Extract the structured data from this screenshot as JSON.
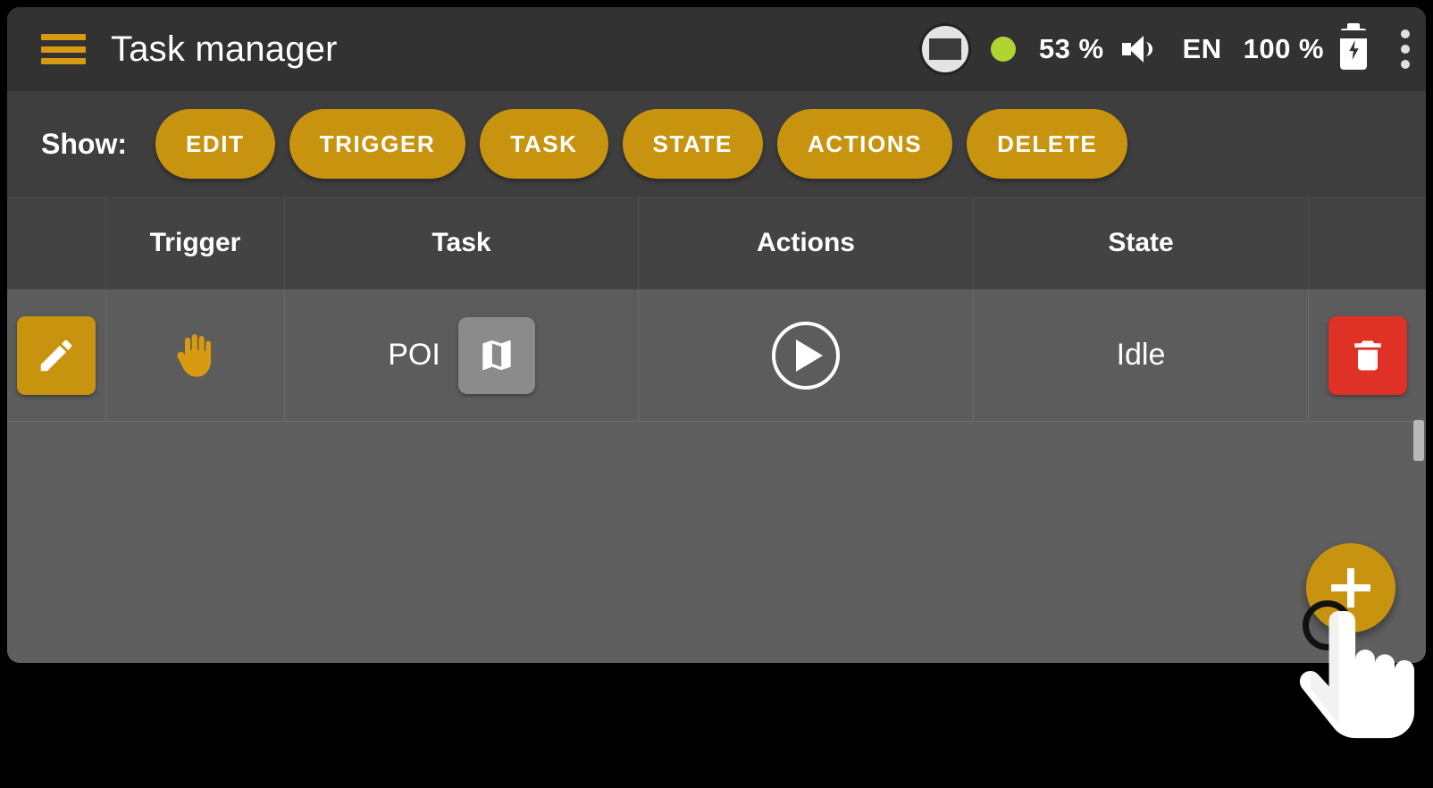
{
  "appbar": {
    "menu_icon": "hamburger-menu-icon",
    "title": "Task manager",
    "status": {
      "cast_icon": "screen-cast-icon",
      "status_dot": "green-status-dot",
      "volume_percent": "53 %",
      "volume_icon": "speaker-icon",
      "language": "EN",
      "battery_percent": "100 %",
      "battery_icon": "battery-charging-icon",
      "overflow_icon": "more-vertical-icon"
    }
  },
  "filterbar": {
    "label": "Show:",
    "chips": [
      {
        "label": "EDIT"
      },
      {
        "label": "TRIGGER"
      },
      {
        "label": "TASK"
      },
      {
        "label": "STATE"
      },
      {
        "label": "ACTIONS"
      },
      {
        "label": "DELETE"
      }
    ]
  },
  "table": {
    "headers": {
      "edit": "",
      "trigger": "Trigger",
      "task": "Task",
      "actions": "Actions",
      "state": "State",
      "delete": ""
    },
    "rows": [
      {
        "edit_icon": "pencil-icon",
        "trigger_icon": "open-hand-icon",
        "trigger_glyph": "✋",
        "task_label": "POI",
        "task_icon": "map-icon",
        "action_icon": "play-icon",
        "state": "Idle",
        "delete_icon": "trash-icon"
      }
    ]
  },
  "fab": {
    "icon": "plus-icon",
    "label": "+"
  },
  "colors": {
    "accent": "#c8940f",
    "accent_light": "#d79a10",
    "danger": "#e03127",
    "appbar_bg": "#323232",
    "filterbar_bg": "#3e3e3e",
    "header_row_bg": "#434343",
    "data_row_bg": "#5c5c5c",
    "body_bg": "#5f5f5f",
    "status_dot": "#b0d431"
  }
}
